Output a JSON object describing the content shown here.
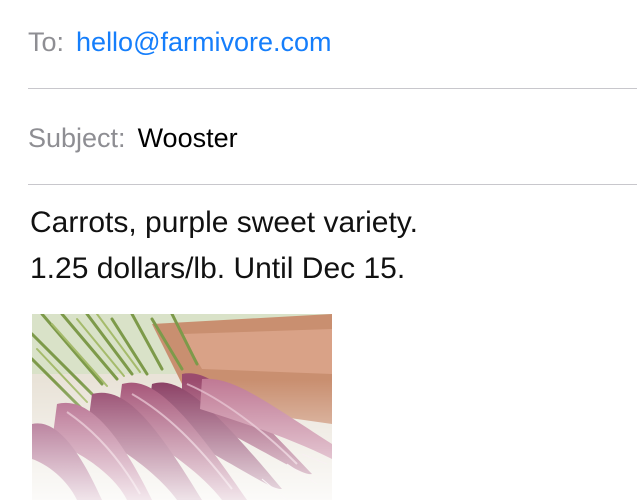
{
  "compose": {
    "to_label": "To:",
    "to_value": "hello@farmivore.com",
    "subject_label": "Subject:",
    "subject_value": "Wooster",
    "body_lines": [
      "Carrots, purple sweet variety.",
      "1.25 dollars/lb. Until Dec 15."
    ],
    "attachment": {
      "icon": "carrots-photo",
      "description_visible": false
    }
  },
  "colors": {
    "link": "#157efb",
    "label": "#8e8e93",
    "divider": "#c8c7cc"
  }
}
